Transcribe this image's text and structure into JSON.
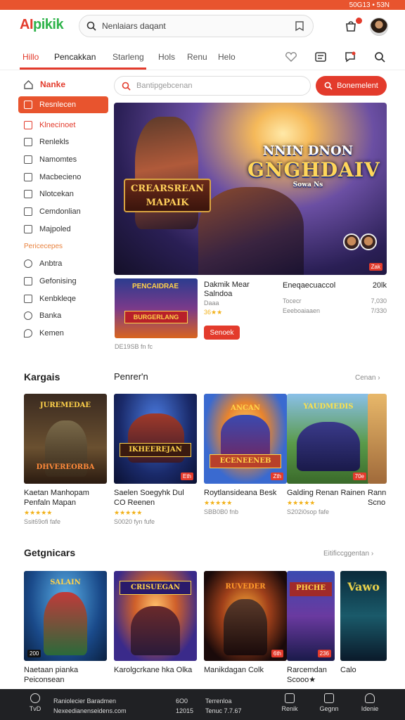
{
  "status": {
    "right_text": "50G13 • 53N"
  },
  "header": {
    "logo_a": "AI",
    "logo_b": "pikik",
    "search_placeholder": "Nenlaiars daqant",
    "icons": [
      "search-icon",
      "bookmark-icon",
      "bag-icon",
      "profile-avatar"
    ]
  },
  "nav": {
    "tabs": [
      "Hillo",
      "Pencakkan",
      "Starleng",
      "Hols",
      "Renu",
      "Helo"
    ],
    "active_index": 0
  },
  "sidebar": {
    "heading": "Nanke",
    "items": [
      "Resnlecen",
      "Klnecinoet",
      "Renlekls",
      "Namomtes",
      "Macbecieno",
      "Nlotcekan",
      "Cemdonlian",
      "Majpoled"
    ],
    "category_label": "Pericecepes",
    "items2": [
      "Anbtra",
      "Gefonising",
      "Kenbkleqe",
      "Banka",
      "Kemen"
    ]
  },
  "main": {
    "search_placeholder": "Bantipgebcenan",
    "search_button": "Bonemelent",
    "hero": {
      "sign_left": "CREARSREAN MAPAIK",
      "sign_right_line1": "NNIN DNON",
      "sign_right_line2": "GNGHDAIV",
      "sign_right_line3": "Sowa Ns",
      "tag": "Zak"
    },
    "featured": {
      "banner_top": "PENCAIDRAE",
      "banner": "BURGERLANG",
      "title_line1": "Dakmik Mear",
      "title_line2": "Salndoa",
      "title_line3": "Daaa",
      "rating": "36★★",
      "button": "Senoek",
      "footer": "DE19SB fn fc",
      "col2_title": "Eneqaecuaccol",
      "col2_line1": "Tocecr",
      "col2_line2": "Eeeboaiaaen",
      "col3_title": "20lk",
      "col3_line1": "7,030",
      "col3_line2": "7/330"
    }
  },
  "sections": [
    {
      "title": "Kargais",
      "subtitle": "Penrer'n",
      "see_all": "Cenan ›",
      "cards": [
        {
          "banner_top": "JUREMEDAE",
          "banner": "DHVEREORBA",
          "title": "Kaetan Manhopam Penfaln Mapan",
          "rating": "★★★★★",
          "meta": "Ssit69ofi fafe",
          "tag": ""
        },
        {
          "banner_top": "",
          "banner": "IKHEEREJAN",
          "title": "Saelen Soegyhk Dul CO Reenen",
          "rating": "★★★★★",
          "meta": "S0020 fyn fufe",
          "tag": "Eth"
        },
        {
          "banner_top": "ANCAN",
          "banner": "ECENEENEB",
          "title": "Roytlansideana Besk",
          "rating": "★★★★★",
          "meta": "SBB0B0 fnb",
          "tag": "Zth"
        },
        {
          "banner_top": "YAUDMEDIS",
          "banner": "",
          "title": "Galding Renan Rainen",
          "rating": "★★★★★",
          "meta": "S202i0sop fafe",
          "tag": "70e"
        },
        {
          "banner_top": "",
          "banner": "",
          "title": "Rann Scno",
          "rating": "",
          "meta": "",
          "tag": ""
        }
      ]
    },
    {
      "title": "Getgnicars",
      "see_all": "Eitificcggentan ›",
      "cards": [
        {
          "banner": "SALAIN",
          "title": "Naetaan pianka Peiconsean",
          "meta": "",
          "tag": "200"
        },
        {
          "banner": "CRISUEGAN",
          "title": "Karolgcrkane hka Olka",
          "meta": "",
          "tag": ""
        },
        {
          "banner": "RUVEDER",
          "title": "Manikdagan Colk",
          "meta": "",
          "tag": "6th"
        },
        {
          "banner": "PHCHE",
          "title": "Rarcemdan Scooo★",
          "meta": "",
          "tag": "236"
        },
        {
          "banner": "Vawo",
          "title": "Calo",
          "meta": "",
          "tag": ""
        }
      ]
    }
  ],
  "bottom": {
    "left_line1": "Raniolecier Baradmen",
    "left_line2": "Nexeedianenseidens.com",
    "left_label": "TvD",
    "mid_line1": "6O0",
    "mid_line2": "12015",
    "mid2_line1": "Terrenloa",
    "mid2_line2": "Tenuc 7.7.67",
    "tabs": [
      "Renik",
      "Gegnn",
      "Idenie"
    ]
  }
}
